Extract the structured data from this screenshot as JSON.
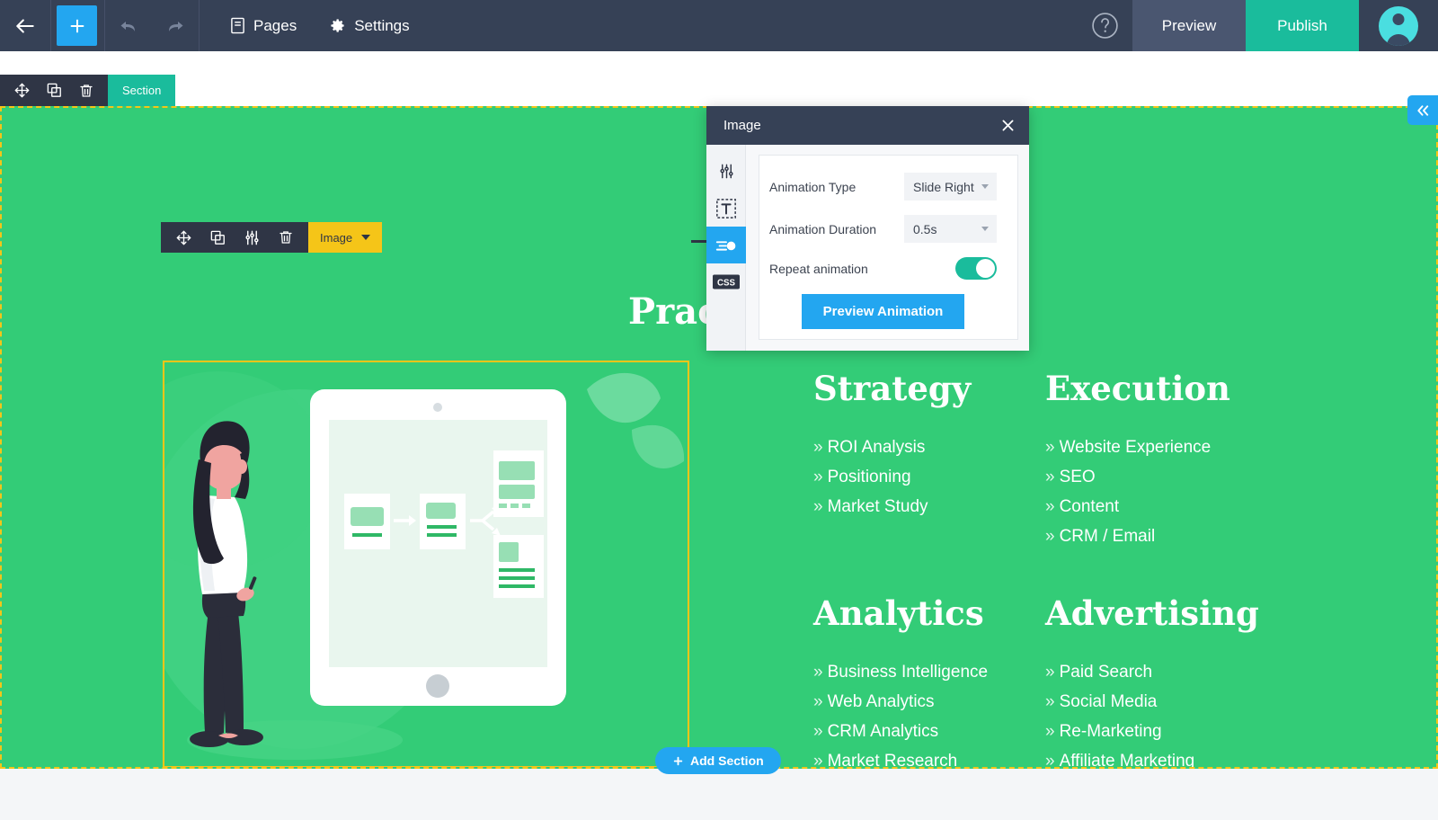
{
  "topbar": {
    "back_icon": "arrow-left-icon",
    "add_icon": "plus-icon",
    "undo_icon": "undo-arrow-icon",
    "redo_icon": "redo-arrow-icon",
    "pages_label": "Pages",
    "pages_icon": "page-document-icon",
    "settings_label": "Settings",
    "settings_icon": "gear-icon",
    "help_icon": "question-mark-circle-icon",
    "preview_label": "Preview",
    "publish_label": "Publish",
    "avatar_icon": "user-avatar-icon",
    "publish_color": "#1abc9c",
    "bar_color": "#364156",
    "accent_blue": "#23a6f0"
  },
  "section_toolbar": {
    "move_icon": "move-arrows-icon",
    "duplicate_icon": "copy-duplicate-icon",
    "delete_icon": "trash-icon",
    "label": "Section",
    "label_color": "#1abc9c"
  },
  "image_toolbar": {
    "move_icon": "move-arrows-icon",
    "duplicate_icon": "copy-duplicate-icon",
    "settings_icon": "sliders-settings-icon",
    "delete_icon": "trash-icon",
    "label": "Image",
    "label_color": "#f5c518",
    "dropdown_icon": "chevron-down-icon"
  },
  "canvas": {
    "background_color": "#33cc77",
    "selection_border_color": "#f5c518",
    "resize_handle_icon": "resize-vertical-icon",
    "collapse_icon": "chevron-double-left-icon",
    "add_section_label": "Add Section",
    "add_section_icon": "plus-icon",
    "add_section_color": "#23a6f0"
  },
  "content": {
    "truncated_heading": "Prac",
    "columns": [
      {
        "heading": "Strategy",
        "items": [
          "ROI Analysis",
          "Positioning",
          "Market Study"
        ]
      },
      {
        "heading": "Execution",
        "items": [
          "Website Experience",
          "SEO",
          "Content",
          "CRM / Email"
        ]
      },
      {
        "heading": "Analytics",
        "items": [
          "Business Intelligence",
          "Web Analytics",
          "CRM Analytics",
          "Market Research"
        ]
      },
      {
        "heading": "Advertising",
        "items": [
          "Paid Search",
          "Social Media",
          "Re-Marketing",
          "Affiliate Marketing"
        ]
      }
    ],
    "bullet": "»"
  },
  "panel": {
    "title": "Image",
    "close_icon": "close-x-icon",
    "rail": [
      {
        "name": "sliders-settings-icon",
        "active": false
      },
      {
        "name": "text-box-icon",
        "active": false
      },
      {
        "name": "animation-toggle-icon",
        "active": true
      },
      {
        "name": "css-code-icon",
        "active": false
      }
    ],
    "fields": [
      {
        "label": "Animation Type",
        "value": "Slide Right"
      },
      {
        "label": "Animation Duration",
        "value": "0.5s"
      }
    ],
    "repeat": {
      "label": "Repeat animation",
      "enabled": true,
      "color": "#1abc9c"
    },
    "preview_button": "Preview Animation",
    "preview_button_color": "#23a6f0",
    "header_color": "#364156"
  }
}
